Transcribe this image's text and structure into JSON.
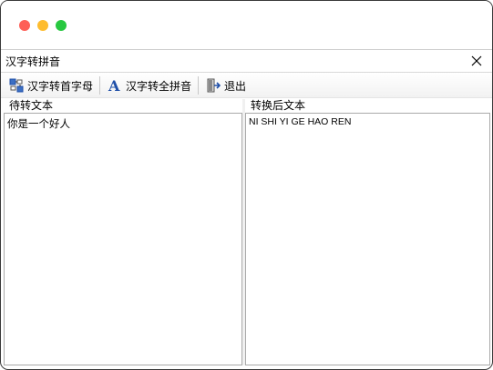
{
  "window": {
    "title": "汉字转拼音"
  },
  "toolbar": {
    "first_letter_label": "汉字转首字母",
    "full_pinyin_label": "汉字转全拼音",
    "exit_label": "退出"
  },
  "input_panel": {
    "label": "待转文本",
    "value": "你是一个好人"
  },
  "output_panel": {
    "label": "转换后文本",
    "value": "NI SHI YI GE HAO REN"
  },
  "colors": {
    "close_dot": "#fe5f57",
    "minimize_dot": "#febc2e",
    "maximize_dot": "#28c840",
    "toolbar_icon_blue": "#1f4fa8"
  }
}
